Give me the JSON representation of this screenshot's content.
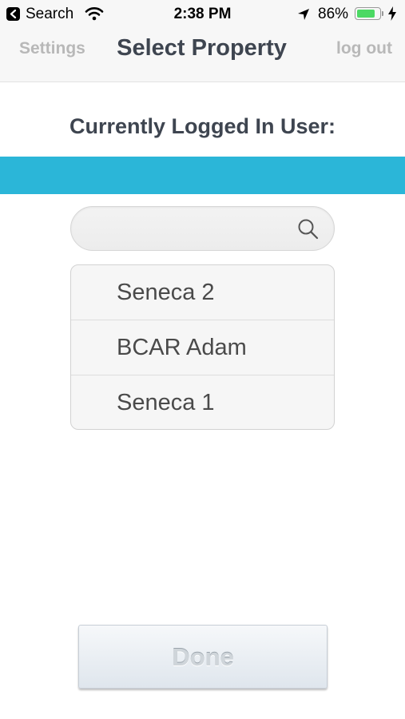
{
  "status_bar": {
    "back_app_label": "Search",
    "time": "2:38 PM",
    "battery_percent": "86%",
    "battery_level": 0.86,
    "icons": [
      "back-arrow-icon",
      "wifi-icon",
      "location-arrow-icon",
      "battery-icon",
      "charging-bolt-icon"
    ]
  },
  "nav": {
    "left_label": "Settings",
    "title": "Select Property",
    "right_label": "log out"
  },
  "current_user": {
    "heading": "Currently Logged In User:",
    "name": "",
    "bar_color": "#2bb6d8"
  },
  "search": {
    "value": "",
    "placeholder": "",
    "icon": "search-icon"
  },
  "properties": [
    {
      "label": "Seneca 2"
    },
    {
      "label": "BCAR Adam"
    },
    {
      "label": "Seneca 1"
    }
  ],
  "done_label": "Done"
}
